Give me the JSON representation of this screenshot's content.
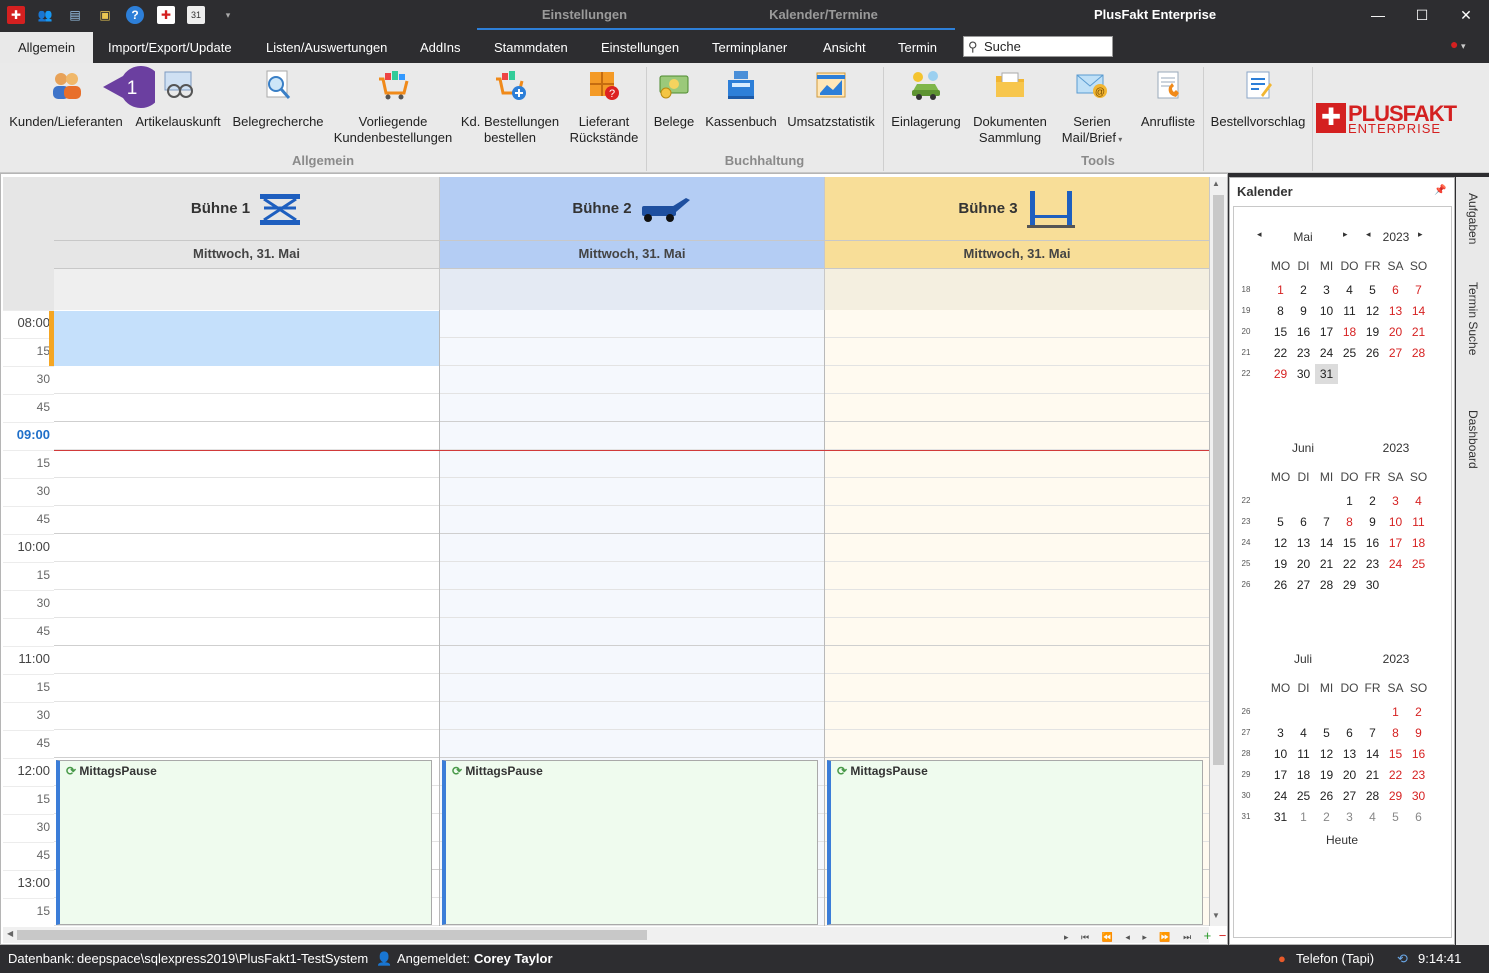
{
  "titlebar": {
    "app_title": "PlusFakt Enterprise",
    "context_tabs": [
      "Einstellungen",
      "Kalender/Termine"
    ]
  },
  "tabs": [
    "Allgemein",
    "Import/Export/Update",
    "Listen/Auswertungen",
    "AddIns",
    "Stammdaten",
    "Einstellungen",
    "Terminplaner",
    "Ansicht",
    "Termin"
  ],
  "search": {
    "placeholder": "Suche"
  },
  "ribbon": {
    "callout_number": "1",
    "buttons": {
      "kunden": "Kunden/Lieferanten",
      "artikel": "Artikelauskunft",
      "beleg": "Belegrecherche",
      "vorliegende_1": "Vorliegende",
      "vorliegende_2": "Kundenbestellungen",
      "kd_1": "Kd. Bestellungen",
      "kd_2": "bestellen",
      "lief_1": "Lieferant",
      "lief_2": "Rückstände",
      "belege": "Belege",
      "kassenbuch": "Kassenbuch",
      "umsatz": "Umsatzstatistik",
      "einlagerung": "Einlagerung",
      "dok_1": "Dokumenten",
      "dok_2": "Sammlung",
      "serien_1": "Serien",
      "serien_2": "Mail/Brief",
      "anrufliste": "Anrufliste",
      "bestellvorschlag": "Bestellvorschlag"
    },
    "groups": {
      "allgemein": "Allgemein",
      "buchhaltung": "Buchhaltung",
      "tools": "Tools"
    },
    "logo_1": "PLUSFAKT",
    "logo_2": "ENTERPRISE"
  },
  "scheduler": {
    "resources": [
      {
        "name": "Bühne 1",
        "date": "Mittwoch, 31. Mai",
        "color": "#e6e6e6"
      },
      {
        "name": "Bühne 2",
        "date": "Mittwoch, 31. Mai",
        "color": "#b4cdf4"
      },
      {
        "name": "Bühne 3",
        "date": "Mittwoch, 31. Mai",
        "color": "#f8de98"
      }
    ],
    "times": [
      "08:00",
      "15",
      "30",
      "45",
      "09:00",
      "15",
      "30",
      "45",
      "10:00",
      "15",
      "30",
      "45",
      "11:00",
      "15",
      "30",
      "45",
      "12:00",
      "15",
      "30",
      "45",
      "13:00",
      "15"
    ],
    "appointment": "MittagsPause"
  },
  "calendar": {
    "title": "Kalender",
    "dow": [
      "MO",
      "DI",
      "MI",
      "DO",
      "FR",
      "SA",
      "SO"
    ],
    "months": [
      {
        "name": "Mai",
        "year": "2023",
        "weeks": [
          "18",
          "19",
          "20",
          "21",
          "22"
        ]
      },
      {
        "name": "Juni",
        "year": "2023",
        "weeks": [
          "22",
          "23",
          "24",
          "25",
          "26"
        ]
      },
      {
        "name": "Juli",
        "year": "2023",
        "weeks": [
          "26",
          "27",
          "28",
          "29",
          "30",
          "31"
        ]
      }
    ],
    "today_label": "Heute"
  },
  "side_tabs": [
    "Aufgaben",
    "Termin Suche",
    "Dashboard"
  ],
  "status": {
    "db_label": "Datenbank:",
    "db_value": "deepspace\\sqlexpress2019\\PlusFakt1-TestSystem",
    "user_label": "Angemeldet:",
    "user_value": "Corey Taylor",
    "phone": "Telefon (Tapi)",
    "clock": "9:14:41"
  },
  "colors": {
    "accent": "#2d7fd8",
    "brand_red": "#d42020",
    "callout": "#6b3fa0"
  }
}
